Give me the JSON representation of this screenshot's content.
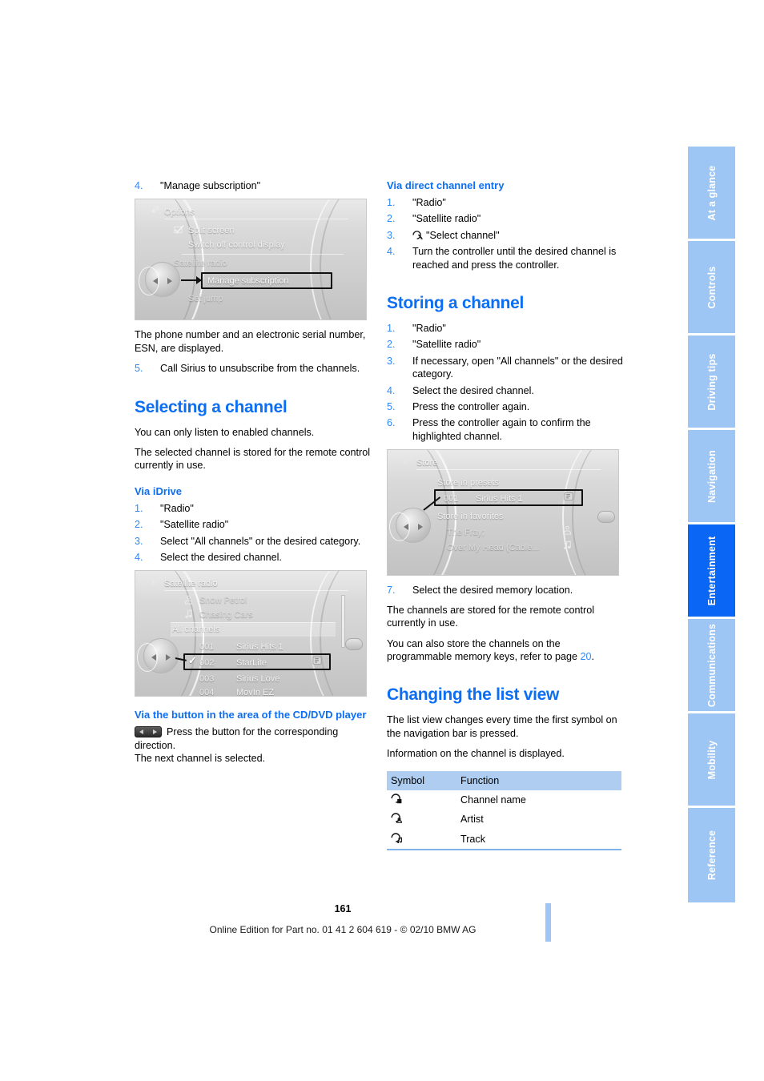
{
  "page": {
    "number": "161",
    "footer": "Online Edition for Part no. 01 41 2 604 619 - © 02/10 BMW AG",
    "accent_blue": "#0c6ef2",
    "step_blue": "#2f89f5",
    "tab_blue": "#9dc6f5",
    "tab_active_blue": "#0a67f5",
    "table_header_blue": "#aecdf0"
  },
  "left_column": {
    "step4": {
      "num": "4.",
      "text": "\"Manage subscription\""
    },
    "options_screen": {
      "title": "Options",
      "title_icon": "options-gear-icon",
      "rows": [
        {
          "label": "Split screen",
          "icon": "checkbox-checked-icon"
        },
        {
          "label": "Switch off control display"
        },
        {
          "label": "Satellite radio"
        },
        {
          "label": "Manage subscription",
          "highlighted": true
        },
        {
          "label": "Set jump"
        }
      ]
    },
    "para_esn": "The phone number and an electronic serial number, ESN, are displayed.",
    "step5": {
      "num": "5.",
      "text": "Call Sirius to unsubscribe from the channels."
    },
    "heading_selecting": "Selecting a channel",
    "para_enabled": "You can only listen to enabled channels.",
    "para_remote": "The selected channel is stored for the remote control currently in use.",
    "heading_via_idrive": "Via iDrive",
    "idrive_steps": [
      {
        "num": "1.",
        "text": "\"Radio\""
      },
      {
        "num": "2.",
        "text": "\"Satellite radio\""
      },
      {
        "num": "3.",
        "text": "Select \"All channels\" or the desired category."
      },
      {
        "num": "4.",
        "text": "Select the desired channel."
      }
    ],
    "satellite_screen": {
      "title": "Satellite radio",
      "title_icon": "satellite-radio-icon",
      "artist": "Snow Petrol",
      "artist_icon": "artist-icon",
      "track": "Chasing Cars",
      "track_icon": "music-note-icon",
      "band_label": "All channels",
      "channels": [
        {
          "num": "001",
          "name": "Sirius Hits 1"
        },
        {
          "num": "002",
          "name": "StarLite",
          "selected": true,
          "checkmark": "✓",
          "badge_icon": "preset-badge-icon"
        },
        {
          "num": "003",
          "name": "Sirius Love"
        },
        {
          "num": "004",
          "name": "MovIn EZ"
        }
      ]
    },
    "heading_via_button": "Via the button in the area of the CD/DVD player",
    "button_icon": "skip-prev-next-button-icon",
    "para_press_button": "Press the button for the corresponding direction.",
    "para_next_channel": "The next channel is selected."
  },
  "right_column": {
    "heading_direct_entry": "Via direct channel entry",
    "direct_steps": [
      {
        "num": "1.",
        "text": "\"Radio\""
      },
      {
        "num": "2.",
        "text": "\"Satellite radio\""
      },
      {
        "num": "3.",
        "text": "\"Select channel\"",
        "icon": "select-channel-icon"
      },
      {
        "num": "4.",
        "text": "Turn the controller until the desired channel is reached and press the controller."
      }
    ],
    "heading_storing": "Storing a channel",
    "storing_steps": [
      {
        "num": "1.",
        "text": "\"Radio\""
      },
      {
        "num": "2.",
        "text": "\"Satellite radio\""
      },
      {
        "num": "3.",
        "text": "If necessary, open \"All channels\" or the desired category."
      },
      {
        "num": "4.",
        "text": "Select the desired channel."
      },
      {
        "num": "5.",
        "text": "Press the controller again."
      },
      {
        "num": "6.",
        "text": "Press the controller again to confirm the highlighted channel."
      }
    ],
    "store_screen": {
      "title": "Store",
      "title_icon": "store-icon",
      "presets_label": "Store in presets",
      "preset_row": {
        "num": "001",
        "name": "Sirius Hits 1",
        "badge_icon": "preset-badge-icon",
        "highlighted": true
      },
      "favorites_label": "Store in favorites",
      "favorites": [
        {
          "name": "The Fray;",
          "icon": "artist-icon"
        },
        {
          "name": "Over My Head (Cable...",
          "icon": "music-note-icon"
        }
      ]
    },
    "step7": {
      "num": "7.",
      "text": "Select the desired memory location."
    },
    "para_stored": "The channels are stored for the remote control currently in use.",
    "para_progkeys_a": "You can also store the channels on the programmable memory keys, refer to page ",
    "para_progkeys_ref": "20",
    "para_progkeys_b": ".",
    "heading_changing": "Changing the list view",
    "para_listview": "The list view changes every time the first symbol on the navigation bar is pressed.",
    "para_info": "Information on the channel is displayed.",
    "table": {
      "headers": [
        "Symbol",
        "Function"
      ],
      "rows": [
        {
          "symbol_icon": "channel-name-symbol-icon",
          "function": "Channel name"
        },
        {
          "symbol_icon": "artist-symbol-icon",
          "function": "Artist"
        },
        {
          "symbol_icon": "track-symbol-icon",
          "function": "Track"
        }
      ]
    }
  },
  "sidebar": {
    "tabs": [
      {
        "label": "At a glance",
        "active": false
      },
      {
        "label": "Controls",
        "active": false
      },
      {
        "label": "Driving tips",
        "active": false
      },
      {
        "label": "Navigation",
        "active": false
      },
      {
        "label": "Entertainment",
        "active": true
      },
      {
        "label": "Communications",
        "active": false
      },
      {
        "label": "Mobility",
        "active": false
      },
      {
        "label": "Reference",
        "active": false
      }
    ]
  }
}
